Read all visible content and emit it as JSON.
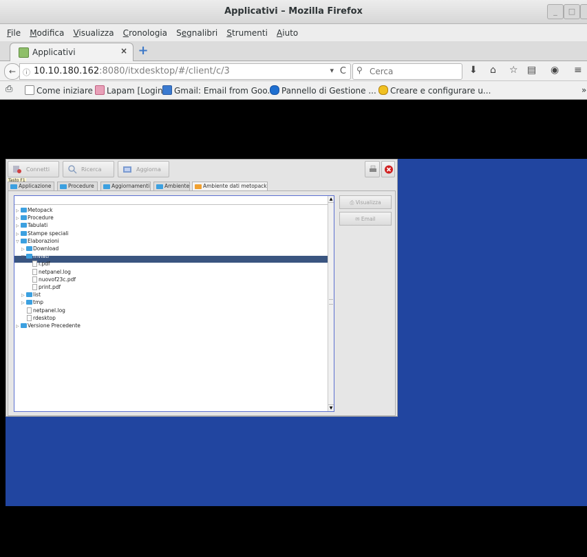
{
  "window": {
    "title": "Applicativi – Mozilla Firefox",
    "min_glyph": "_",
    "max_glyph": "□",
    "close_glyph": "×"
  },
  "menu": {
    "items": [
      {
        "u": "F",
        "rest": "ile"
      },
      {
        "u": "M",
        "rest": "odifica"
      },
      {
        "u": "V",
        "rest": "isualizza"
      },
      {
        "u": "C",
        "rest": "ronologia"
      },
      {
        "pre": "S",
        "u": "e",
        "rest": "gnalibri"
      },
      {
        "u": "S",
        "rest": "trumenti"
      },
      {
        "u": "A",
        "rest": "iuto"
      }
    ]
  },
  "tab": {
    "label": "Applicativi",
    "close": "×",
    "new_tab": "+"
  },
  "nav": {
    "back_glyph": "←",
    "url_host": "10.10.180.162",
    "url_rest": ":8080/itxdesktop/#/client/c/3",
    "dropdown_glyph": "▾",
    "reload_glyph": "C",
    "search_placeholder": "Cerca",
    "search_glyph": "⚲",
    "download_glyph": "⬇",
    "home_glyph": "⌂",
    "bookmark_glyph": "☆",
    "reading_glyph": "▤",
    "pocket_glyph": "◉",
    "menu_glyph": "≡"
  },
  "bookmarks": {
    "print_glyph": "⎙",
    "items": [
      {
        "label": "Come iniziare",
        "color": "#ffffff",
        "border": "#888888"
      },
      {
        "label": "Lapam [Login]",
        "color": "#e8a0b8",
        "border": "#c06080"
      },
      {
        "label": "Gmail: Email from Goo...",
        "color": "#3a7ad0",
        "border": "#2a5aa0"
      },
      {
        "label": "Pannello di Gestione ...",
        "color": "#1e6fd0",
        "border": "#1550a0"
      },
      {
        "label": "Creare e configurare u...",
        "color": "#f0c020",
        "border": "#b08010"
      }
    ],
    "overflow": "»"
  },
  "app": {
    "toolbar": {
      "connetti": "Connetti",
      "ricerca": "Ricerca",
      "aggiorna": "Aggiorna"
    },
    "tooltip": "Tasto F1",
    "tabs": [
      "Applicazione",
      "Procedure",
      "Aggiornamenti",
      "Ambiente",
      "Ambiente dati metopack"
    ],
    "side_buttons": {
      "visualizza": "Visualizza",
      "email": "Email"
    },
    "tree": [
      {
        "label": "Metopack",
        "type": "folder",
        "level": 0,
        "expanded": false
      },
      {
        "label": "Procedure",
        "type": "folder",
        "level": 0,
        "expanded": false
      },
      {
        "label": "Tabulati",
        "type": "folder",
        "level": 0,
        "expanded": false
      },
      {
        "label": "Stampe speciali",
        "type": "folder",
        "level": 0,
        "expanded": false
      },
      {
        "label": "Elaborazioni",
        "type": "folder",
        "level": 0,
        "expanded": true
      },
      {
        "label": "Download",
        "type": "folder",
        "level": 1,
        "expanded": false
      },
      {
        "label": "Inviati",
        "type": "folder",
        "level": 1,
        "expanded": true,
        "selected": true
      },
      {
        "label": "l.pdf",
        "type": "file",
        "level": 3
      },
      {
        "label": "netpanel.log",
        "type": "file",
        "level": 3
      },
      {
        "label": "nuovof23c.pdf",
        "type": "file",
        "level": 3
      },
      {
        "label": "print.pdf",
        "type": "file",
        "level": 3
      },
      {
        "label": "list",
        "type": "folder",
        "level": 1,
        "expanded": false
      },
      {
        "label": "tmp",
        "type": "folder",
        "level": 1,
        "expanded": false
      },
      {
        "label": "netpanel.log",
        "type": "file",
        "level": 2
      },
      {
        "label": "rdesktop",
        "type": "file",
        "level": 2
      },
      {
        "label": "Versione Precedente",
        "type": "folder",
        "level": 0,
        "expanded": false
      }
    ]
  },
  "colors": {
    "desktop_blue": "#2145a0",
    "selection": "#3a5580",
    "folder": "#3ca0e0"
  }
}
